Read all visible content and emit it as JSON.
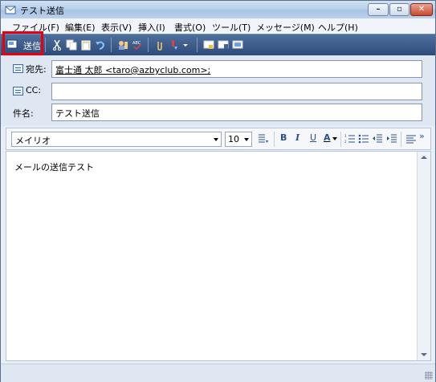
{
  "window": {
    "title": "テスト送信"
  },
  "menu": [
    "ファイル(F)",
    "編集(E)",
    "表示(V)",
    "挿入(I)",
    "書式(O)",
    "ツール(T)",
    "メッセージ(M)",
    "ヘルプ(H)"
  ],
  "toolbar": {
    "send_label": "送信"
  },
  "fields": {
    "to_label": "宛先:",
    "to_value": "富士通 太郎 <taro@azbyclub.com>;",
    "cc_label": "CC:",
    "cc_value": "",
    "subject_label": "件名:",
    "subject_value": "テスト送信"
  },
  "format": {
    "font": "メイリオ",
    "size": "10",
    "bold": "B",
    "italic": "I",
    "underline": "U",
    "font_color": "A",
    "more": "»"
  },
  "body": {
    "text": "メールの送信テスト"
  },
  "colors": {
    "toolbar": "#3a5a8a",
    "highlight": "#e60012"
  }
}
